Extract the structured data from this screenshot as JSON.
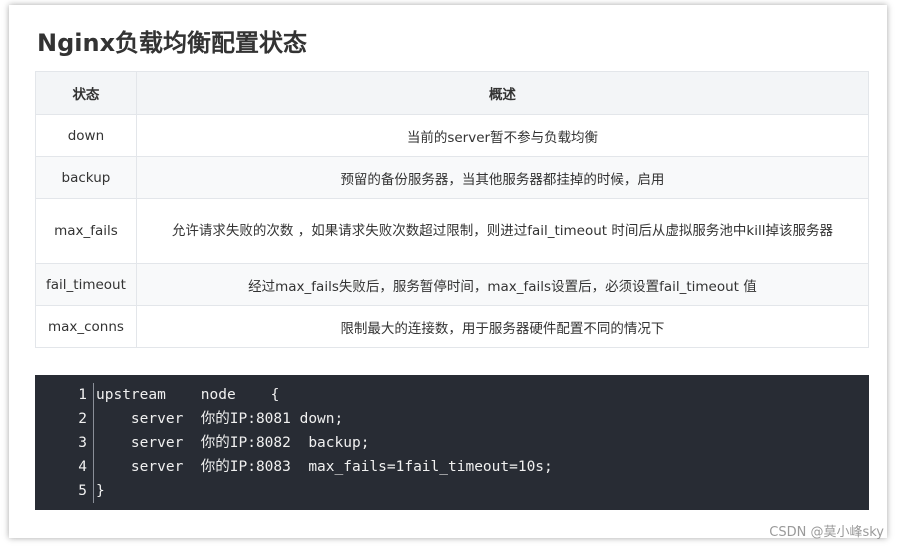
{
  "title": "Nginx负载均衡配置状态",
  "table": {
    "headers": [
      "状态",
      "概述"
    ],
    "rows": [
      {
        "state": "down",
        "desc": "当前的server暂不参与负载均衡"
      },
      {
        "state": "backup",
        "desc": "预留的备份服务器，当其他服务器都挂掉的时候，启用"
      },
      {
        "state": "max_fails",
        "desc": "允许请求失败的次数 ，如果请求失败次数超过限制，则进过fail_timeout 时间后从虚拟服务池中kill掉该服务器"
      },
      {
        "state": "fail_timeout",
        "desc": "经过max_fails失败后，服务暂停时间，max_fails设置后，必须设置fail_timeout 值"
      },
      {
        "state": "max_conns",
        "desc": "限制最大的连接数，用于服务器硬件配置不同的情况下"
      }
    ]
  },
  "code": {
    "line_numbers": [
      "1",
      "2",
      "3",
      "4",
      "5"
    ],
    "lines": [
      "upstream    node    {",
      "    server  你的IP:8081 down;",
      "    server  你的IP:8082  backup;",
      "    server  你的IP:8083  max_fails=1fail_timeout=10s;",
      "}"
    ]
  },
  "watermark": "CSDN @莫小峰sky"
}
